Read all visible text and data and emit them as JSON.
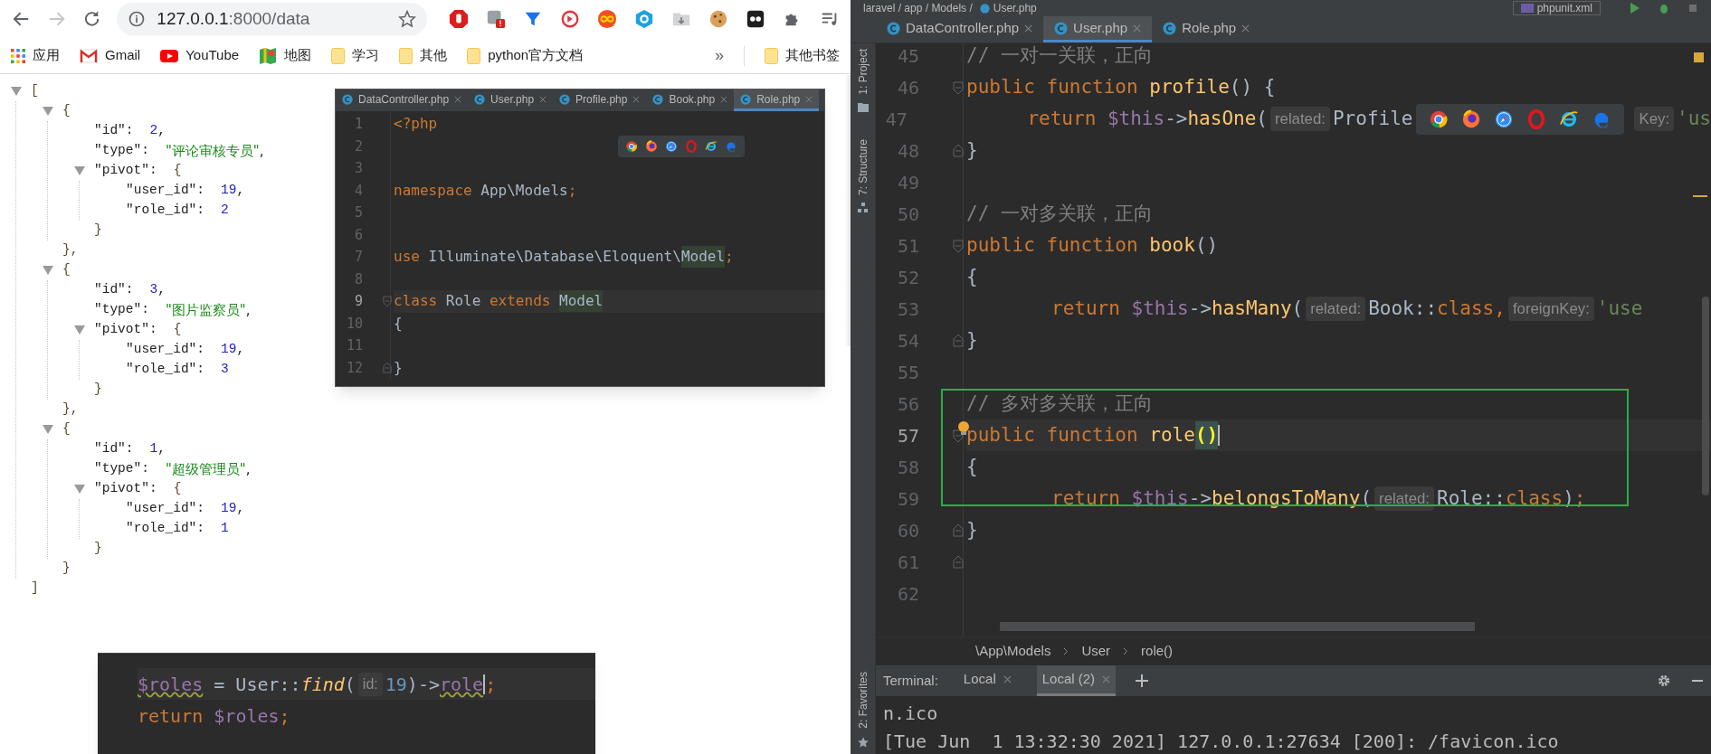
{
  "browser": {
    "nav": {
      "back_enabled": true,
      "forward_enabled": false
    },
    "url": {
      "host": "127.0.0.1",
      "path": ":8000/data"
    },
    "bookmarks": [
      {
        "kind": "apps",
        "label": "应用"
      },
      {
        "kind": "mail",
        "label": "Gmail"
      },
      {
        "kind": "video",
        "label": "YouTube"
      },
      {
        "kind": "map",
        "label": "地图"
      },
      {
        "kind": "folder",
        "label": "学习"
      },
      {
        "kind": "folder",
        "label": "其他"
      },
      {
        "kind": "folder",
        "label": "python官方文档"
      }
    ],
    "overflow": "»",
    "other_bookmarks": "其他书签"
  },
  "json_view": {
    "expanded": true,
    "open": "[",
    "close": "]",
    "items": [
      {
        "expanded": true,
        "open": "{",
        "close": "},",
        "fields": [
          {
            "key": "\"id\":",
            "value": "2",
            "kind": "number",
            "after": ","
          },
          {
            "key": "\"type\":",
            "value": "\"评论审核专员\"",
            "kind": "string",
            "after": ","
          },
          {
            "key": "\"pivot\":",
            "expanded": true,
            "open": "{",
            "close": "}",
            "fields": [
              {
                "key": "\"user_id\":",
                "value": "19",
                "kind": "number",
                "after": ","
              },
              {
                "key": "\"role_id\":",
                "value": "2",
                "kind": "number"
              }
            ]
          }
        ]
      },
      {
        "expanded": true,
        "open": "{",
        "close": "},",
        "fields": [
          {
            "key": "\"id\":",
            "value": "3",
            "kind": "number",
            "after": ","
          },
          {
            "key": "\"type\":",
            "value": "\"图片监察员\"",
            "kind": "string",
            "after": ","
          },
          {
            "key": "\"pivot\":",
            "expanded": true,
            "open": "{",
            "close": "}",
            "fields": [
              {
                "key": "\"user_id\":",
                "value": "19",
                "kind": "number",
                "after": ","
              },
              {
                "key": "\"role_id\":",
                "value": "3",
                "kind": "number"
              }
            ]
          }
        ]
      },
      {
        "expanded": true,
        "open": "{",
        "close": "}",
        "fields": [
          {
            "key": "\"id\":",
            "value": "1",
            "kind": "number",
            "after": ","
          },
          {
            "key": "\"type\":",
            "value": "\"超级管理员\"",
            "kind": "string",
            "after": ","
          },
          {
            "key": "\"pivot\":",
            "expanded": true,
            "open": "{",
            "close": "}",
            "fields": [
              {
                "key": "\"user_id\":",
                "value": "19",
                "kind": "number",
                "after": ","
              },
              {
                "key": "\"role_id\":",
                "value": "1",
                "kind": "number"
              }
            ]
          }
        ]
      }
    ]
  },
  "popup_editor": {
    "tabs": [
      {
        "label": "DataController.php",
        "selected": false
      },
      {
        "label": "User.php",
        "selected": false
      },
      {
        "label": "Profile.php",
        "selected": false
      },
      {
        "label": "Book.php",
        "selected": false
      },
      {
        "label": "Role.php",
        "selected": true
      }
    ],
    "lines": [
      {
        "number": "1",
        "tokens": [
          {
            "kind": "kw",
            "text": "<?php"
          }
        ]
      },
      {
        "number": "2",
        "tokens": [
          {
            "kind": "covered"
          }
        ]
      },
      {
        "number": "3"
      },
      {
        "number": "4",
        "tokens": [
          {
            "kind": "kw",
            "text": "namespace "
          },
          {
            "kind": "plain",
            "text": "App\\Models"
          },
          {
            "kind": "kw",
            "text": ";"
          }
        ]
      },
      {
        "number": "5"
      },
      {
        "number": "6"
      },
      {
        "number": "7",
        "tokens": [
          {
            "kind": "kw",
            "text": "use "
          },
          {
            "kind": "plain",
            "text": "Illuminate\\Database\\Eloquent\\"
          },
          {
            "kind": "hl",
            "text": "Model"
          },
          {
            "kind": "kw",
            "text": ";"
          }
        ]
      },
      {
        "number": "8"
      },
      {
        "number": "9",
        "current": true,
        "fold": {
          "kind": "start"
        },
        "tokens": [
          {
            "kind": "kw",
            "text": "class "
          },
          {
            "kind": "plain",
            "text": "Role "
          },
          {
            "kind": "kw",
            "text": "extends "
          },
          {
            "kind": "hl",
            "text": "Model"
          }
        ]
      },
      {
        "number": "10",
        "tokens": [
          {
            "kind": "plain",
            "text": "{"
          }
        ]
      },
      {
        "number": "11"
      },
      {
        "number": "12",
        "fold": {
          "kind": "end"
        },
        "tokens": [
          {
            "kind": "plain",
            "text": "}"
          }
        ]
      }
    ]
  },
  "snippet": {
    "lines": [
      {
        "current": true,
        "tokens": [
          {
            "kind": "warn",
            "text": "$roles"
          },
          {
            "kind": "plain",
            "text": " = User::"
          },
          {
            "kind": "ifn",
            "text": "find"
          },
          {
            "kind": "plain",
            "text": "("
          },
          {
            "kind": "hint",
            "text": "id:"
          },
          {
            "kind": "num",
            "text": "19"
          },
          {
            "kind": "plain",
            "text": ")->"
          },
          {
            "kind": "warn",
            "text": "role"
          },
          {
            "kind": "caret"
          },
          {
            "kind": "kw",
            "text": ";"
          }
        ]
      },
      {
        "tokens": [
          {
            "kind": "kw",
            "text": "return "
          },
          {
            "kind": "var",
            "text": "$roles"
          },
          {
            "kind": "kw",
            "text": ";"
          }
        ]
      }
    ]
  },
  "ide": {
    "top_bar": {
      "path": "laravel / app / Models /",
      "file": "User.php",
      "run_config": "phpunit.xml"
    },
    "tool_windows": [
      {
        "kind": "project",
        "label": "1: Project"
      },
      {
        "kind": "structure",
        "label": "7: Structure"
      },
      {
        "kind": "favorites",
        "label": "2: Favorites"
      }
    ],
    "tabs": [
      {
        "label": "DataController.php",
        "selected": false
      },
      {
        "label": "User.php",
        "selected": true
      },
      {
        "label": "Role.php",
        "selected": false
      }
    ],
    "lines": [
      {
        "number": "45",
        "tokens": [
          {
            "kind": "comment",
            "text": "// 一对一关联，正向"
          }
        ]
      },
      {
        "number": "46",
        "fold": {
          "kind": "start"
        },
        "tokens": [
          {
            "kind": "kw",
            "text": "public function "
          },
          {
            "kind": "fn",
            "text": "profile"
          },
          {
            "kind": "plain",
            "text": "() {"
          }
        ]
      },
      {
        "number": "47",
        "indented": true,
        "tokens": [
          {
            "kind": "kw",
            "text": "return "
          },
          {
            "kind": "var",
            "text": "$this"
          },
          {
            "kind": "plain",
            "text": "->"
          },
          {
            "kind": "fn",
            "text": "hasOne"
          },
          {
            "kind": "plain",
            "text": "("
          },
          {
            "kind": "hint",
            "text": "related:"
          },
          {
            "kind": "plain",
            "text": "Profile"
          },
          {
            "kind": "covered"
          },
          {
            "kind": "hint",
            "text": "Key:"
          },
          {
            "kind": "str",
            "text": "'us"
          }
        ]
      },
      {
        "number": "48",
        "fold": {
          "kind": "end"
        },
        "tokens": [
          {
            "kind": "plain",
            "text": "}"
          }
        ]
      },
      {
        "number": "49"
      },
      {
        "number": "50",
        "tokens": [
          {
            "kind": "comment",
            "text": "// 一对多关联，正向"
          }
        ]
      },
      {
        "number": "51",
        "fold": {
          "kind": "start"
        },
        "tokens": [
          {
            "kind": "kw",
            "text": "public function "
          },
          {
            "kind": "fn",
            "text": "book"
          },
          {
            "kind": "plain",
            "text": "()"
          }
        ]
      },
      {
        "number": "52",
        "tokens": [
          {
            "kind": "plain",
            "text": "{"
          }
        ]
      },
      {
        "number": "53",
        "indented": true,
        "tokens": [
          {
            "kind": "kw",
            "text": "return "
          },
          {
            "kind": "var",
            "text": "$this"
          },
          {
            "kind": "plain",
            "text": "->"
          },
          {
            "kind": "fn",
            "text": "hasMany"
          },
          {
            "kind": "plain",
            "text": "("
          },
          {
            "kind": "hint",
            "text": "related:"
          },
          {
            "kind": "plain",
            "text": "Book::"
          },
          {
            "kind": "kw",
            "text": "class,"
          },
          {
            "kind": "hint",
            "text": "foreignKey:"
          },
          {
            "kind": "str",
            "text": "'use"
          }
        ]
      },
      {
        "number": "54",
        "fold": {
          "kind": "end"
        },
        "tokens": [
          {
            "kind": "plain",
            "text": "}"
          }
        ]
      },
      {
        "number": "55"
      },
      {
        "number": "56",
        "tokens": [
          {
            "kind": "comment",
            "text": "// 多对多关联，正向"
          }
        ]
      },
      {
        "number": "57",
        "current": true,
        "bulb": true,
        "fold": {
          "kind": "start"
        },
        "tokens": [
          {
            "kind": "kw",
            "text": "public function "
          },
          {
            "kind": "fn",
            "text": "role"
          },
          {
            "kind": "match",
            "text": "()"
          },
          {
            "kind": "caret"
          }
        ]
      },
      {
        "number": "58",
        "tokens": [
          {
            "kind": "plain",
            "text": "{"
          }
        ]
      },
      {
        "number": "59",
        "indented": true,
        "tokens": [
          {
            "kind": "kw",
            "text": "return "
          },
          {
            "kind": "var",
            "text": "$this"
          },
          {
            "kind": "plain",
            "text": "->"
          },
          {
            "kind": "fn",
            "text": "belongsToMany"
          },
          {
            "kind": "plain",
            "text": "("
          },
          {
            "kind": "hint",
            "text": "related:"
          },
          {
            "kind": "plain",
            "text": "Role::"
          },
          {
            "kind": "kw",
            "text": "class"
          },
          {
            "kind": "plain",
            "text": ")"
          },
          {
            "kind": "kw",
            "text": ";"
          }
        ]
      },
      {
        "number": "60",
        "fold": {
          "kind": "end"
        },
        "tokens": [
          {
            "kind": "plain",
            "text": "}"
          }
        ]
      },
      {
        "number": "61",
        "fold": {
          "kind": "end"
        }
      },
      {
        "number": "62"
      }
    ],
    "breadcrumbs": [
      "\\App\\Models",
      "User",
      "role()"
    ],
    "terminal": {
      "title": "Terminal:",
      "tabs": [
        {
          "label": "Local",
          "selected": false
        },
        {
          "label": "Local (2)",
          "selected": true
        }
      ],
      "output": [
        "n.ico",
        "[Tue Jun  1 13:32:30 2021] 127.0.0.1:27634 [200]: /favicon.ico"
      ]
    }
  }
}
